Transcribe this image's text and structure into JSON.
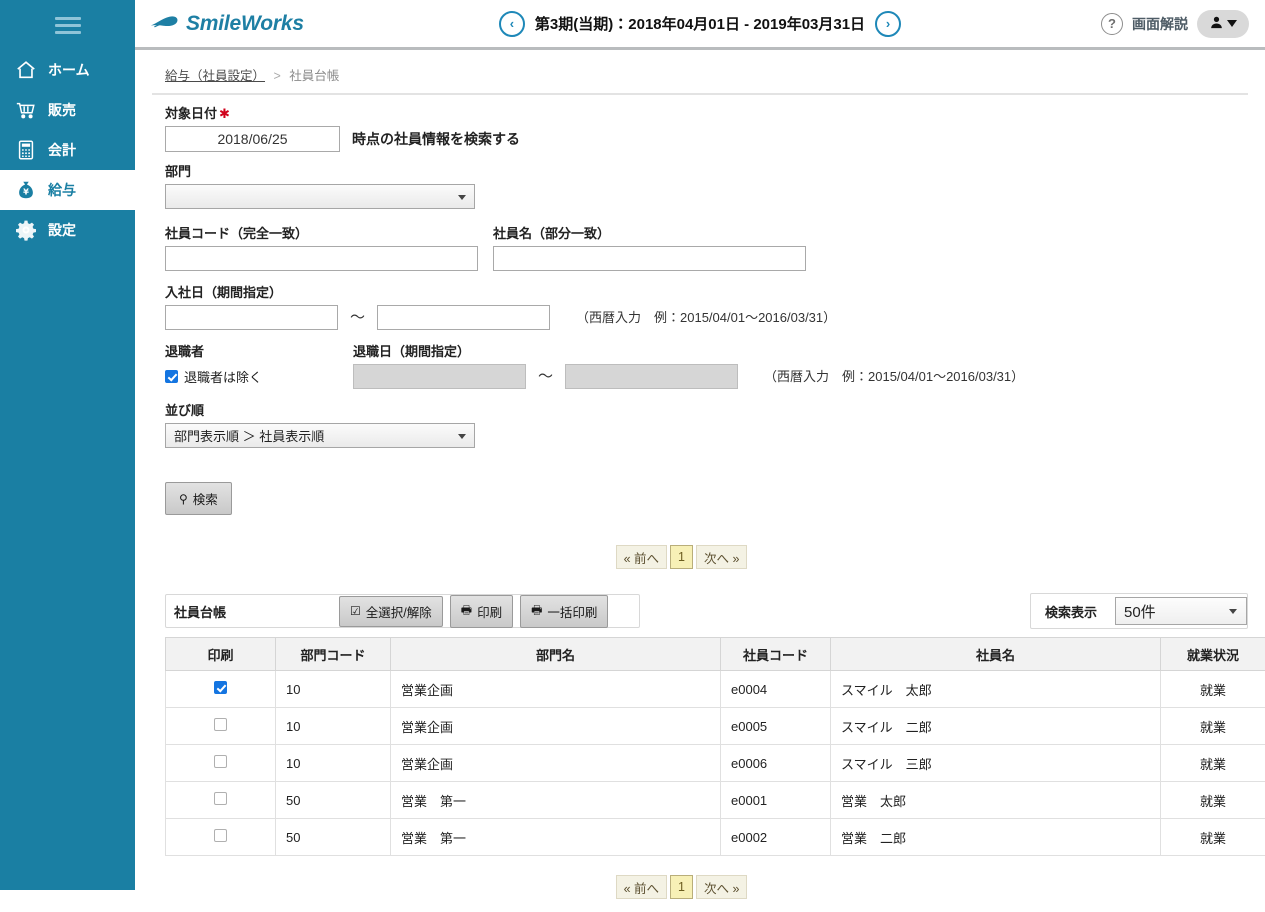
{
  "sidebar": {
    "menu_icon": "hamburger-icon",
    "items": [
      {
        "label": "ホーム",
        "icon": "home-icon",
        "active": false
      },
      {
        "label": "販売",
        "icon": "cart-icon",
        "active": false
      },
      {
        "label": "会計",
        "icon": "calculator-icon",
        "active": false
      },
      {
        "label": "給与",
        "icon": "money-bag-icon",
        "active": true
      },
      {
        "label": "設定",
        "icon": "gear-icon",
        "active": false
      }
    ]
  },
  "topbar": {
    "logo_text": "SmileWorks",
    "prev_period_label": "‹",
    "next_period_label": "›",
    "period_text": "第3期(当期)：2018年04月01日 - 2019年03月31日",
    "help_icon_label": "?",
    "help_label": "画面解説",
    "user_menu_label": "user-avatar"
  },
  "breadcrumb": {
    "parent": "給与（社員設定）",
    "separator": ">",
    "current": "社員台帳"
  },
  "search_form": {
    "target_date": {
      "label": "対象日付",
      "required_mark": "✱",
      "value": "2018/06/25",
      "suffix_text": "時点の社員情報を検索する"
    },
    "department": {
      "label": "部門",
      "value": ""
    },
    "employee_code": {
      "label": "社員コード（完全一致）",
      "value": ""
    },
    "employee_name": {
      "label": "社員名（部分一致）",
      "value": ""
    },
    "join_date": {
      "label": "入社日（期間指定）",
      "from": "",
      "to": "",
      "tilde": "～",
      "hint": "（西暦入力　例：2015/04/01〜2016/03/31）"
    },
    "retiree": {
      "label": "退職者",
      "checkbox_label": "退職者は除く",
      "checked": true
    },
    "retire_date": {
      "label": "退職日（期間指定）",
      "from": "",
      "to": "",
      "tilde": "～",
      "hint": "（西暦入力　例：2015/04/01〜2016/03/31）",
      "disabled": true
    },
    "sort_order": {
      "label": "並び順",
      "value": "部門表示順 ＞ 社員表示順"
    },
    "search_button": {
      "label": "検索",
      "icon": "search-icon"
    }
  },
  "pagination": {
    "prev_label": "« 前へ",
    "current_page": "1",
    "next_label": "次へ »"
  },
  "table_toolbar": {
    "title": "社員台帳",
    "select_all_label": "全選択/解除",
    "select_all_icon": "checkbox-icon",
    "print_label": "印刷",
    "print_icon": "printer-icon",
    "bulk_print_label": "一括印刷",
    "bulk_print_icon": "printer-icon"
  },
  "search_display": {
    "label": "検索表示",
    "count_value": "50件"
  },
  "table": {
    "columns": [
      "印刷",
      "部門コード",
      "部門名",
      "社員コード",
      "社員名",
      "就業状況"
    ],
    "rows": [
      {
        "checked": true,
        "dept_code": "10",
        "dept_name": "営業企画",
        "emp_code": "e0004",
        "emp_name": "スマイル　太郎",
        "status": "就業"
      },
      {
        "checked": false,
        "dept_code": "10",
        "dept_name": "営業企画",
        "emp_code": "e0005",
        "emp_name": "スマイル　二郎",
        "status": "就業"
      },
      {
        "checked": false,
        "dept_code": "10",
        "dept_name": "営業企画",
        "emp_code": "e0006",
        "emp_name": "スマイル　三郎",
        "status": "就業"
      },
      {
        "checked": false,
        "dept_code": "50",
        "dept_name": "営業　第一",
        "emp_code": "e0001",
        "emp_name": "営業　太郎",
        "status": "就業"
      },
      {
        "checked": false,
        "dept_code": "50",
        "dept_name": "営業　第一",
        "emp_code": "e0002",
        "emp_name": "営業　二郎",
        "status": "就業"
      }
    ]
  },
  "colors": {
    "sidebar": "#1a7fa3",
    "brand": "#1e7fa4",
    "accent_check": "#1475e1",
    "page_current": "#f7f0b6"
  }
}
